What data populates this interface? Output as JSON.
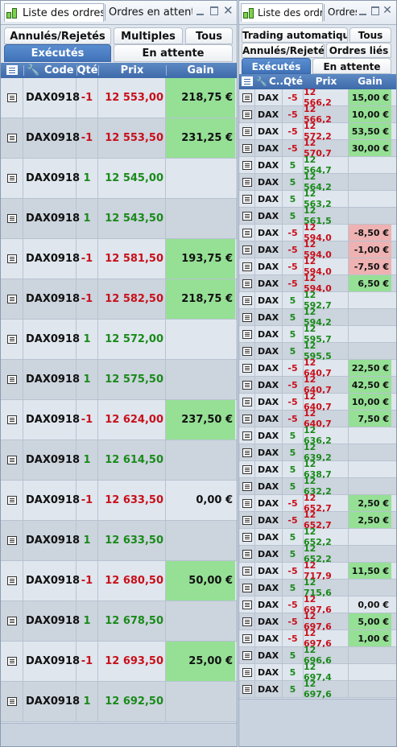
{
  "left": {
    "window_tabs": [
      "Liste des ordres",
      "Ordres en attente"
    ],
    "filter_tabs_row1": [
      "Annulés/Rejetés",
      "Multiples",
      "Tous"
    ],
    "filter_tabs_row2": [
      "Exécutés",
      "En attente"
    ],
    "active_tab": "Exécutés",
    "columns": {
      "code": "Code",
      "qty": "Qté",
      "price": "Prix",
      "gain": "Gain"
    },
    "rows": [
      {
        "code": "DAX0918",
        "qty": "-1",
        "price": "12 553,00",
        "gain": "218,75 €"
      },
      {
        "code": "DAX0918",
        "qty": "-1",
        "price": "12 553,50",
        "gain": "231,25 €"
      },
      {
        "code": "DAX0918",
        "qty": "1",
        "price": "12 545,00",
        "gain": ""
      },
      {
        "code": "DAX0918",
        "qty": "1",
        "price": "12 543,50",
        "gain": ""
      },
      {
        "code": "DAX0918",
        "qty": "-1",
        "price": "12 581,50",
        "gain": "193,75 €"
      },
      {
        "code": "DAX0918",
        "qty": "-1",
        "price": "12 582,50",
        "gain": "218,75 €"
      },
      {
        "code": "DAX0918",
        "qty": "1",
        "price": "12 572,00",
        "gain": ""
      },
      {
        "code": "DAX0918",
        "qty": "1",
        "price": "12 575,50",
        "gain": ""
      },
      {
        "code": "DAX0918",
        "qty": "-1",
        "price": "12 624,00",
        "gain": "237,50 €"
      },
      {
        "code": "DAX0918",
        "qty": "1",
        "price": "12 614,50",
        "gain": ""
      },
      {
        "code": "DAX0918",
        "qty": "-1",
        "price": "12 633,50",
        "gain": "0,00 €"
      },
      {
        "code": "DAX0918",
        "qty": "1",
        "price": "12 633,50",
        "gain": ""
      },
      {
        "code": "DAX0918",
        "qty": "-1",
        "price": "12 680,50",
        "gain": "50,00 €"
      },
      {
        "code": "DAX0918",
        "qty": "1",
        "price": "12 678,50",
        "gain": ""
      },
      {
        "code": "DAX0918",
        "qty": "-1",
        "price": "12 693,50",
        "gain": "25,00 €"
      },
      {
        "code": "DAX0918",
        "qty": "1",
        "price": "12 692,50",
        "gain": ""
      }
    ]
  },
  "right": {
    "window_tabs": [
      "Liste des ordres",
      "Ordres"
    ],
    "filter_tabs_row1": [
      "Trading automatique",
      "Tous"
    ],
    "filter_tabs_row2": [
      "Annulés/Rejetés",
      "Ordres liés"
    ],
    "filter_tabs_row3": [
      "Exécutés",
      "En attente"
    ],
    "active_tab": "Exécutés",
    "columns": {
      "code": "C...",
      "qty": "Qté",
      "price": "Prix",
      "gain": "Gain"
    },
    "rows": [
      {
        "code": "DAX",
        "qty": "-5",
        "price": "12 566,2",
        "gain": "15,00 €"
      },
      {
        "code": "DAX",
        "qty": "-5",
        "price": "12 566,2",
        "gain": "10,00 €"
      },
      {
        "code": "DAX",
        "qty": "-5",
        "price": "12 572,2",
        "gain": "53,50 €"
      },
      {
        "code": "DAX",
        "qty": "-5",
        "price": "12 570,7",
        "gain": "30,00 €"
      },
      {
        "code": "DAX",
        "qty": "5",
        "price": "12 564,7",
        "gain": ""
      },
      {
        "code": "DAX",
        "qty": "5",
        "price": "12 564,2",
        "gain": ""
      },
      {
        "code": "DAX",
        "qty": "5",
        "price": "12 563,2",
        "gain": ""
      },
      {
        "code": "DAX",
        "qty": "5",
        "price": "12 561,5",
        "gain": ""
      },
      {
        "code": "DAX",
        "qty": "-5",
        "price": "12 594,0",
        "gain": "-8,50 €"
      },
      {
        "code": "DAX",
        "qty": "-5",
        "price": "12 594,0",
        "gain": "-1,00 €"
      },
      {
        "code": "DAX",
        "qty": "-5",
        "price": "12 594,0",
        "gain": "-7,50 €"
      },
      {
        "code": "DAX",
        "qty": "-5",
        "price": "12 594,0",
        "gain": "6,50 €"
      },
      {
        "code": "DAX",
        "qty": "5",
        "price": "12 592,7",
        "gain": ""
      },
      {
        "code": "DAX",
        "qty": "5",
        "price": "12 594,2",
        "gain": ""
      },
      {
        "code": "DAX",
        "qty": "5",
        "price": "12 595,7",
        "gain": ""
      },
      {
        "code": "DAX",
        "qty": "5",
        "price": "12 595,5",
        "gain": ""
      },
      {
        "code": "DAX",
        "qty": "-5",
        "price": "12 640,7",
        "gain": "22,50 €"
      },
      {
        "code": "DAX",
        "qty": "-5",
        "price": "12 640,7",
        "gain": "42,50 €"
      },
      {
        "code": "DAX",
        "qty": "-5",
        "price": "12 640,7",
        "gain": "10,00 €"
      },
      {
        "code": "DAX",
        "qty": "-5",
        "price": "12 640,7",
        "gain": "7,50 €"
      },
      {
        "code": "DAX",
        "qty": "5",
        "price": "12 636,2",
        "gain": ""
      },
      {
        "code": "DAX",
        "qty": "5",
        "price": "12 639,2",
        "gain": ""
      },
      {
        "code": "DAX",
        "qty": "5",
        "price": "12 638,7",
        "gain": ""
      },
      {
        "code": "DAX",
        "qty": "5",
        "price": "12 632,2",
        "gain": ""
      },
      {
        "code": "DAX",
        "qty": "-5",
        "price": "12 652,7",
        "gain": "2,50 €"
      },
      {
        "code": "DAX",
        "qty": "-5",
        "price": "12 652,7",
        "gain": "2,50 €"
      },
      {
        "code": "DAX",
        "qty": "5",
        "price": "12 652,2",
        "gain": ""
      },
      {
        "code": "DAX",
        "qty": "5",
        "price": "12 652,2",
        "gain": ""
      },
      {
        "code": "DAX",
        "qty": "-5",
        "price": "12 717,9",
        "gain": "11,50 €"
      },
      {
        "code": "DAX",
        "qty": "5",
        "price": "12 715,6",
        "gain": ""
      },
      {
        "code": "DAX",
        "qty": "-5",
        "price": "12 697,6",
        "gain": "0,00 €"
      },
      {
        "code": "DAX",
        "qty": "-5",
        "price": "12 697,6",
        "gain": "5,00 €"
      },
      {
        "code": "DAX",
        "qty": "-5",
        "price": "12 697,6",
        "gain": "1,00 €"
      },
      {
        "code": "DAX",
        "qty": "5",
        "price": "12 696,6",
        "gain": ""
      },
      {
        "code": "DAX",
        "qty": "5",
        "price": "12 697,4",
        "gain": ""
      },
      {
        "code": "DAX",
        "qty": "5",
        "price": "12 697,6",
        "gain": ""
      }
    ]
  },
  "colors": {
    "gain_positive": "#95e095",
    "gain_negative": "#eeb2b2",
    "row_odd": "#dfe6ee",
    "row_even": "#ccd4de",
    "header_blue": "#4a78b8",
    "sell_red": "#c8101a",
    "buy_green": "#1a8a1a"
  },
  "icons": [
    "app-icon",
    "document-icon",
    "wrench-icon",
    "minimize-icon",
    "maximize-icon",
    "close-icon"
  ]
}
